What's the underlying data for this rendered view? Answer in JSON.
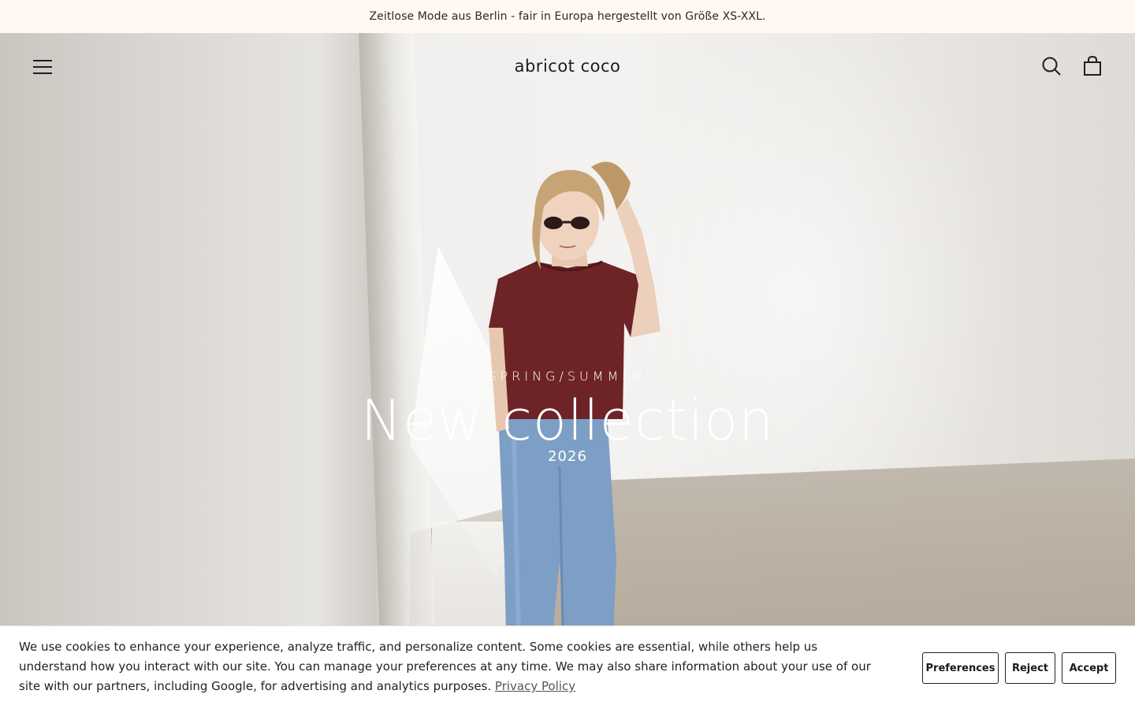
{
  "announcement": {
    "text": "Zeitlose Mode aus Berlin - fair in Europa hergestellt von Größe XS-XXL."
  },
  "header": {
    "menu_icon": "hamburger-menu-icon",
    "logo": "abricot coco",
    "search_icon": "search-icon",
    "cart_icon": "shopping-bag-icon"
  },
  "hero": {
    "eyebrow": "SPRING/SUMMER",
    "headline": "New collection",
    "year": "2026"
  },
  "cookie_banner": {
    "text": "We use cookies to enhance your experience, analyze traffic, and personalize content. Some cookies are essential, while others help us understand how you interact with our site. You can manage your preferences at any time. We may also share information about your use of our site with our partners, including Google, for advertising and analytics purposes.",
    "link_label": "Privacy Policy",
    "preferences_label": "Preferences",
    "reject_label": "Reject",
    "accept_label": "Accept"
  },
  "colors": {
    "announcement_bg": "#fff8f3",
    "shirt": "#6e2327",
    "jeans": "#7d9fc6"
  }
}
